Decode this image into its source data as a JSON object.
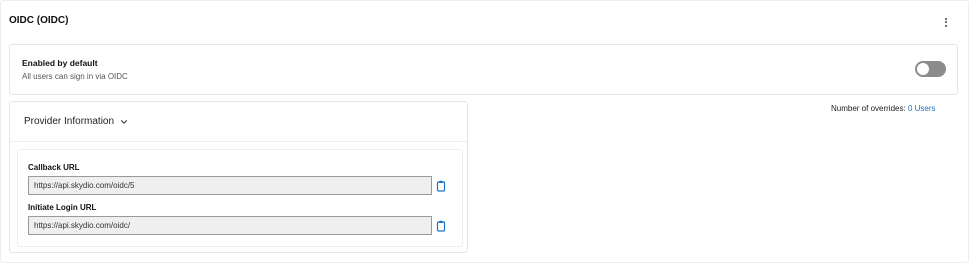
{
  "header": {
    "title": "OIDC (OIDC)",
    "menu_icon": "more-vertical-icon"
  },
  "enabled_card": {
    "title": "Enabled by default",
    "subtitle": "All users can sign in via OIDC",
    "toggle_on": false
  },
  "overrides": {
    "label": "Number of overrides:",
    "link": "0 Users"
  },
  "provider": {
    "header_label": "Provider Information",
    "chevron_icon": "chevron-down-icon",
    "fields": [
      {
        "label": "Callback URL",
        "value": "https://api.skydio.com/oidc/5",
        "copy_icon": "clipboard-icon"
      },
      {
        "label": "Initiate Login URL",
        "value": "https://api.skydio.com/oidc/",
        "copy_icon": "clipboard-icon"
      }
    ]
  },
  "colors": {
    "accent": "#1a73c8",
    "toggle_off": "#8c8c8c",
    "border": "#e6e6e6"
  }
}
